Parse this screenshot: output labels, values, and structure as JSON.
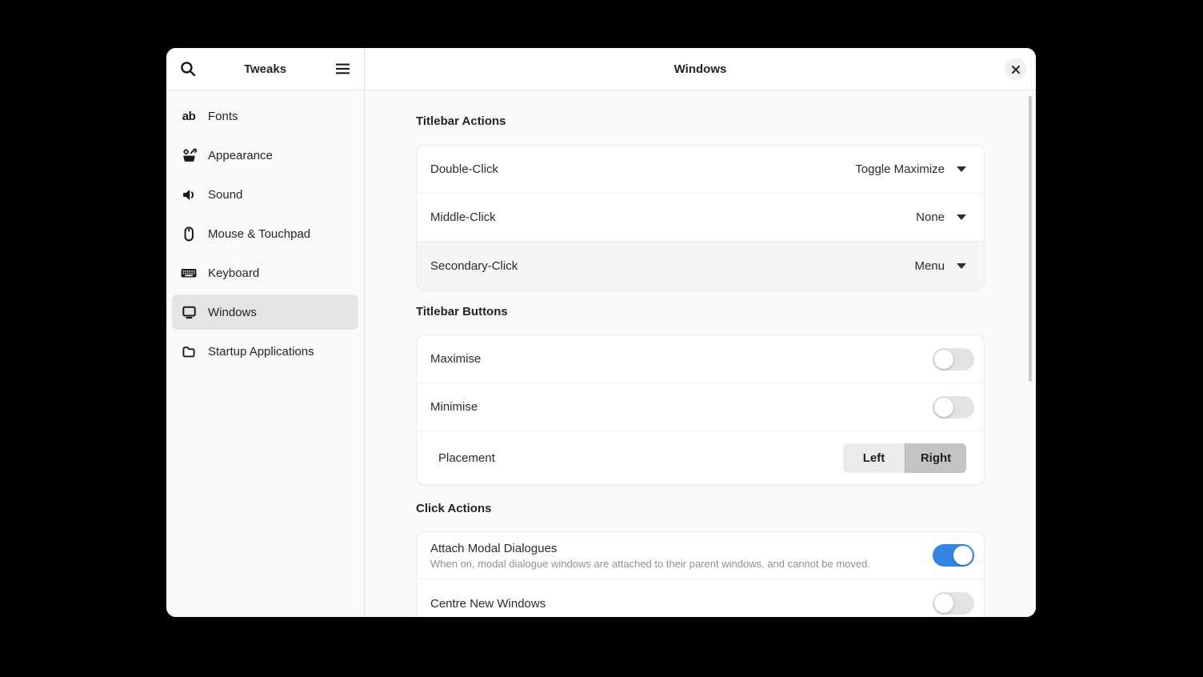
{
  "colors": {
    "accent": "#3584e4",
    "sidebar_selected_bg": "#e4e4e4",
    "segment_active_bg": "#c3c3c3"
  },
  "sidebar": {
    "title": "Tweaks",
    "fonts_glyph": "ab",
    "items": [
      {
        "label": "Fonts",
        "icon": "fonts-ab-icon",
        "selected": false
      },
      {
        "label": "Appearance",
        "icon": "appearance-toolbox-icon",
        "selected": false
      },
      {
        "label": "Sound",
        "icon": "speaker-icon",
        "selected": false
      },
      {
        "label": "Mouse & Touchpad",
        "icon": "mouse-icon",
        "selected": false
      },
      {
        "label": "Keyboard",
        "icon": "keyboard-icon",
        "selected": false
      },
      {
        "label": "Windows",
        "icon": "display-icon",
        "selected": true
      },
      {
        "label": "Startup Applications",
        "icon": "folder-icon",
        "selected": false
      }
    ],
    "icons": {
      "left": "search-icon",
      "right": "hamburger-menu-icon"
    }
  },
  "header": {
    "title": "Windows",
    "close_icon": "close-x-icon"
  },
  "content": {
    "sections": [
      {
        "title": "Titlebar Actions",
        "rows": [
          {
            "label": "Double-Click",
            "control": "dropdown",
            "value": "Toggle Maximize"
          },
          {
            "label": "Middle-Click",
            "control": "dropdown",
            "value": "None"
          },
          {
            "label": "Secondary-Click",
            "control": "dropdown",
            "value": "Menu"
          }
        ]
      },
      {
        "title": "Titlebar Buttons",
        "rows": [
          {
            "label": "Maximise",
            "control": "toggle",
            "state": "off"
          },
          {
            "label": "Minimise",
            "control": "toggle",
            "state": "off"
          },
          {
            "label": "Placement",
            "control": "segmented",
            "options": [
              "Left",
              "Right"
            ],
            "selected": "Right"
          }
        ]
      },
      {
        "title": "Click Actions",
        "rows": [
          {
            "label": "Attach Modal Dialogues",
            "subtitle": "When on, modal dialogue windows are attached to their parent windows, and cannot be moved.",
            "control": "toggle",
            "state": "on"
          },
          {
            "label": "Centre New Windows",
            "control": "toggle",
            "state": "off"
          }
        ]
      }
    ]
  }
}
